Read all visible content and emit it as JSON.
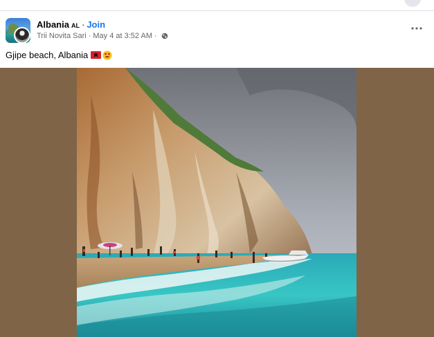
{
  "post": {
    "group_name": "Albania",
    "group_badge": "AL",
    "separator": "·",
    "join_label": "Join",
    "author": "Trii Novita Sari",
    "timestamp": "May 4 at 3:52 AM",
    "privacy_icon": "globe-icon",
    "more_icon": "more-options-icon",
    "caption": "Gjipe beach, Albania",
    "caption_emojis": [
      "albania-flag-emoji",
      "heart-eyes-emoji"
    ]
  },
  "media": {
    "subject": "Beach cove below a tall rocky cliff with turquoise sea and beachgoers",
    "backdrop_color": "#7f6448"
  },
  "colors": {
    "link_blue": "#1877f2",
    "meta_gray": "#65676b",
    "text_dark": "#050505"
  }
}
